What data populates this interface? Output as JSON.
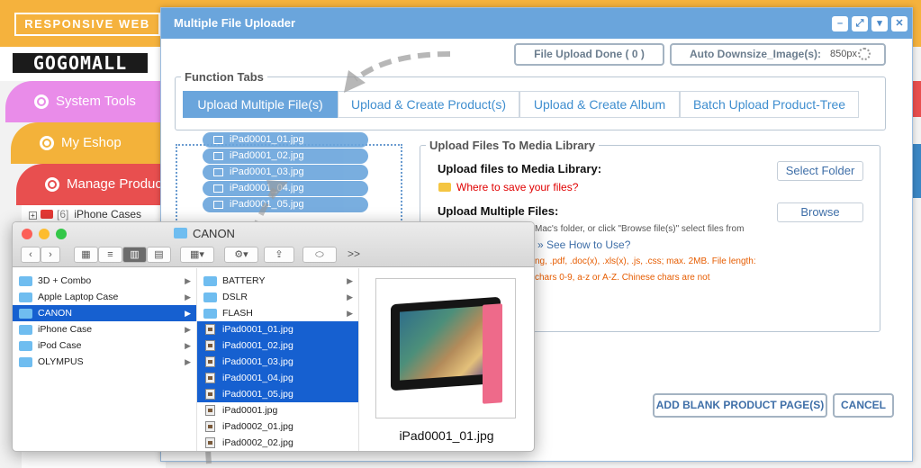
{
  "background": {
    "logo_text": "RESPONSIVE WEB",
    "brand": "GOGOMALL",
    "nav": [
      {
        "label": "System Tools"
      },
      {
        "label": "My Eshop"
      },
      {
        "label": "Manage Product"
      }
    ],
    "tree_item": {
      "count": "[6]",
      "label": "iPhone Cases"
    },
    "colors": {
      "nav1": "#e98ce9",
      "nav2": "#f3b23a",
      "nav3": "#e84f4f",
      "topbar": "#f5b23d"
    }
  },
  "dialog": {
    "title": "Multiple File Uploader",
    "window_controls": [
      "minimize-icon",
      "external-icon",
      "chevron-down-icon",
      "close-icon"
    ],
    "upload_done_label": "File Upload Done ( 0 )",
    "downsize_label": "Auto Downsize_Image(s):",
    "downsize_value": "850px",
    "function_tabs_legend": "Function Tabs",
    "tabs": [
      {
        "label": "Upload Multiple File(s)",
        "active": true
      },
      {
        "label": "Upload & Create Product(s)"
      },
      {
        "label": "Upload & Create Album"
      },
      {
        "label": "Batch Upload Product-Tree"
      }
    ],
    "dropped_files": [
      "iPad0001_01.jpg",
      "iPad0001_02.jpg",
      "iPad0001_03.jpg",
      "iPad0001_04.jpg",
      "iPad0001_05.jpg"
    ],
    "media": {
      "legend": "Upload Files To Media Library",
      "heading1": "Upload files to Media Library:",
      "select_folder_label": "Select Folder",
      "where_label": "Where to save your files?",
      "heading2": "Upload Multiple Files:",
      "browse_label": "Browse",
      "line1": "Mac's folder, or click \"Browse file(s)\" select files from",
      "howto_label": "» See How to Use?",
      "line2": "ng, .pdf, .doc(x), .xls(x), .js, .css; max. 2MB. File length:",
      "line3": "chars 0-9, a-z or A-Z. Chinese chars are not"
    },
    "add_blank_label": "ADD BLANK PRODUCT PAGE(S)",
    "cancel_label": "CANCEL",
    "accent": "#6aa5dc"
  },
  "finder": {
    "title": "CANON",
    "col1": [
      {
        "label": "3D + Combo"
      },
      {
        "label": "Apple Laptop Case"
      },
      {
        "label": "CANON",
        "selected": true
      },
      {
        "label": "iPhone Case"
      },
      {
        "label": "iPod Case"
      },
      {
        "label": "OLYMPUS"
      }
    ],
    "col2": [
      {
        "label": "BATTERY",
        "folder": true
      },
      {
        "label": "DSLR",
        "folder": true
      },
      {
        "label": "FLASH",
        "folder": true
      },
      {
        "label": "iPad0001_01.jpg",
        "selected": true
      },
      {
        "label": "iPad0001_02.jpg",
        "selected": true
      },
      {
        "label": "iPad0001_03.jpg",
        "selected": true
      },
      {
        "label": "iPad0001_04.jpg",
        "selected": true
      },
      {
        "label": "iPad0001_05.jpg",
        "selected": true
      },
      {
        "label": "iPad0001.jpg"
      },
      {
        "label": "iPad0002_01.jpg"
      },
      {
        "label": "iPad0002_02.jpg"
      }
    ],
    "preview_name": "iPad0001_01.jpg",
    "more_label": ">>",
    "selection_color": "#1660d0"
  }
}
